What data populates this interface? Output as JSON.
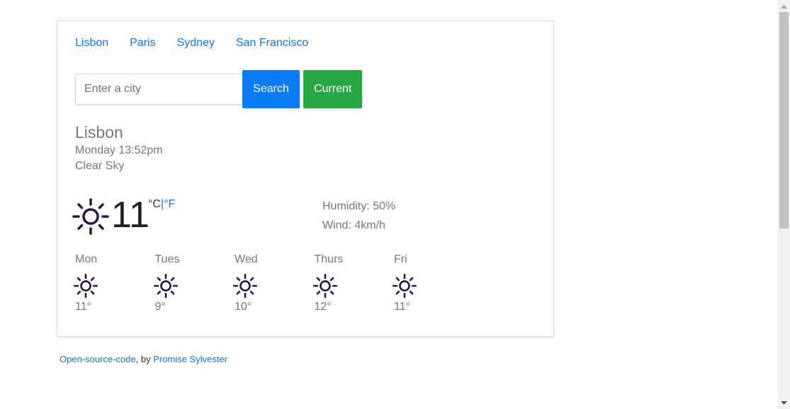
{
  "city_links": [
    "Lisbon",
    "Paris",
    "Sydney",
    "San Francisco"
  ],
  "search": {
    "placeholder": "Enter a city",
    "value": "",
    "search_label": "Search",
    "current_label": "Current"
  },
  "colors": {
    "link": "#1a73e8",
    "search_button": "#0a7cf3",
    "current_button": "#28a745",
    "icon": "#2a1540"
  },
  "weather": {
    "city": "Lisbon",
    "datetime": "Monday 13:52pm",
    "condition": "Clear Sky",
    "icon": "sun-icon",
    "temperature": "11",
    "unit_c": "°C",
    "unit_sep": "|",
    "unit_f": "°F",
    "humidity": "Humidity: 50%",
    "wind": "Wind: 4km/h"
  },
  "forecast": [
    {
      "day": "Mon",
      "temp": "11°",
      "icon": "sun-icon"
    },
    {
      "day": "Tues",
      "temp": "9°",
      "icon": "sun-icon"
    },
    {
      "day": "Wed",
      "temp": "10°",
      "icon": "sun-icon"
    },
    {
      "day": "Thurs",
      "temp": "12°",
      "icon": "sun-icon"
    },
    {
      "day": "Fri",
      "temp": "11°",
      "icon": "sun-icon"
    }
  ],
  "footer": {
    "code_link": "Open-source-code",
    "by_text": ", by ",
    "author_link": "Promise Sylvester"
  }
}
